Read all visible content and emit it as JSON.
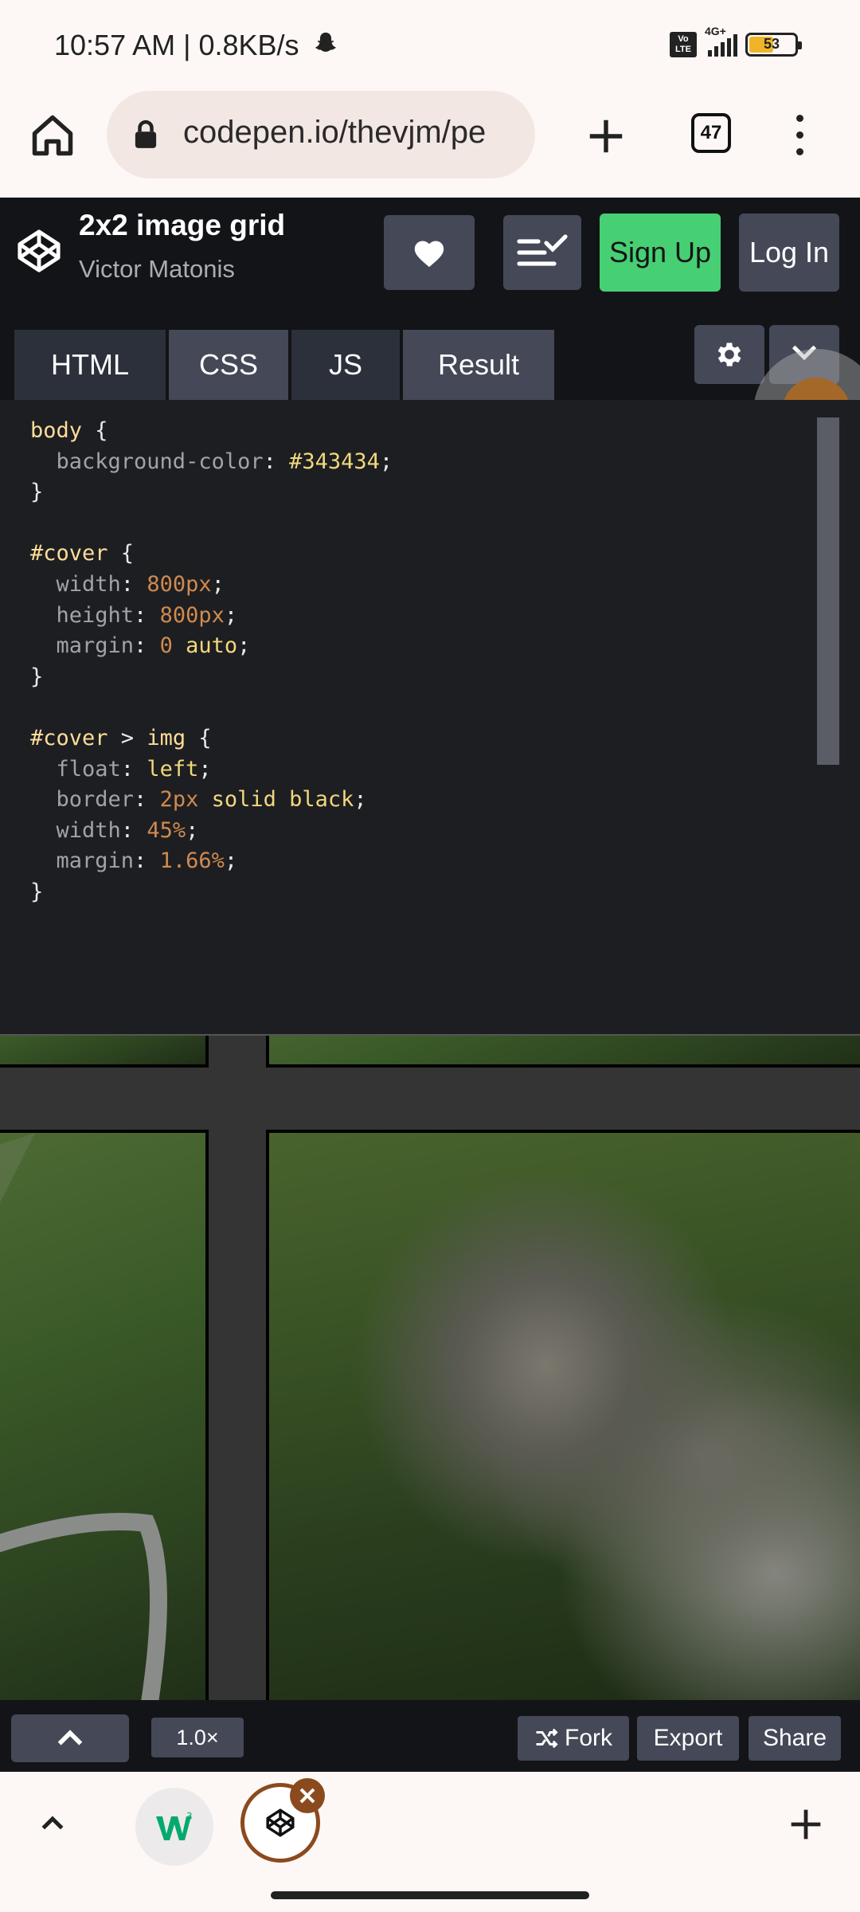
{
  "status_bar": {
    "time_speed": "10:57 AM | 0.8KB/s",
    "network": "4G+",
    "volte": "Vo LTE",
    "battery": "53"
  },
  "browser": {
    "url": "codepen.io/thevjm/pe",
    "tab_count": "47"
  },
  "codepen": {
    "title": "2x2 image grid",
    "author": "Victor Matonis",
    "signup_label": "Sign Up",
    "login_label": "Log In",
    "tabs": [
      "HTML",
      "CSS",
      "JS",
      "Result"
    ]
  },
  "code_lines": [
    [
      {
        "t": "body",
        "c": "sel"
      },
      {
        "t": " {",
        "c": "pun"
      }
    ],
    [
      {
        "t": "  background-color",
        "c": "prop"
      },
      {
        "t": ": ",
        "c": "pun"
      },
      {
        "t": "#343434",
        "c": "val"
      },
      {
        "t": ";",
        "c": "pun"
      }
    ],
    [
      {
        "t": "}",
        "c": "pun"
      }
    ],
    [],
    [
      {
        "t": "#cover",
        "c": "sel"
      },
      {
        "t": " {",
        "c": "pun"
      }
    ],
    [
      {
        "t": "  width",
        "c": "prop"
      },
      {
        "t": ": ",
        "c": "pun"
      },
      {
        "t": "800px",
        "c": "num"
      },
      {
        "t": ";",
        "c": "pun"
      }
    ],
    [
      {
        "t": "  height",
        "c": "prop"
      },
      {
        "t": ": ",
        "c": "pun"
      },
      {
        "t": "800px",
        "c": "num"
      },
      {
        "t": ";",
        "c": "pun"
      }
    ],
    [
      {
        "t": "  margin",
        "c": "prop"
      },
      {
        "t": ": ",
        "c": "pun"
      },
      {
        "t": "0",
        "c": "num"
      },
      {
        "t": " ",
        "c": "pun"
      },
      {
        "t": "auto",
        "c": "val"
      },
      {
        "t": ";",
        "c": "pun"
      }
    ],
    [
      {
        "t": "}",
        "c": "pun"
      }
    ],
    [],
    [
      {
        "t": "#cover",
        "c": "sel"
      },
      {
        "t": " > ",
        "c": "pun"
      },
      {
        "t": "img",
        "c": "sel"
      },
      {
        "t": " {",
        "c": "pun"
      }
    ],
    [
      {
        "t": "  float",
        "c": "prop"
      },
      {
        "t": ": ",
        "c": "pun"
      },
      {
        "t": "left",
        "c": "val"
      },
      {
        "t": ";",
        "c": "pun"
      }
    ],
    [
      {
        "t": "  border",
        "c": "prop"
      },
      {
        "t": ": ",
        "c": "pun"
      },
      {
        "t": "2px",
        "c": "num"
      },
      {
        "t": " ",
        "c": "pun"
      },
      {
        "t": "solid black",
        "c": "val"
      },
      {
        "t": ";",
        "c": "pun"
      }
    ],
    [
      {
        "t": "  width",
        "c": "prop"
      },
      {
        "t": ": ",
        "c": "pun"
      },
      {
        "t": "45%",
        "c": "num"
      },
      {
        "t": ";",
        "c": "pun"
      }
    ],
    [
      {
        "t": "  margin",
        "c": "prop"
      },
      {
        "t": ": ",
        "c": "pun"
      },
      {
        "t": "1.66%",
        "c": "num"
      },
      {
        "t": ";",
        "c": "pun"
      }
    ],
    [
      {
        "t": "}",
        "c": "pun"
      }
    ]
  ],
  "footer": {
    "zoom": "1.0×",
    "fork_label": "Fork",
    "export_label": "Export",
    "share_label": "Share"
  },
  "colors": {
    "codepen_bg": "#131417",
    "editor_bg": "#1d1e22",
    "button_gray": "#444857",
    "signup_green": "#47cf73",
    "preview_bg": "#343434"
  },
  "icons": [
    "home-icon",
    "lock-icon",
    "plus-icon",
    "tab-count-icon",
    "more-vert-icon",
    "codepen-logo-icon",
    "heart-icon",
    "layout-icon",
    "gear-icon",
    "chevron-down-icon",
    "chevron-up-icon",
    "fork-icon",
    "w3schools-icon",
    "close-icon"
  ]
}
